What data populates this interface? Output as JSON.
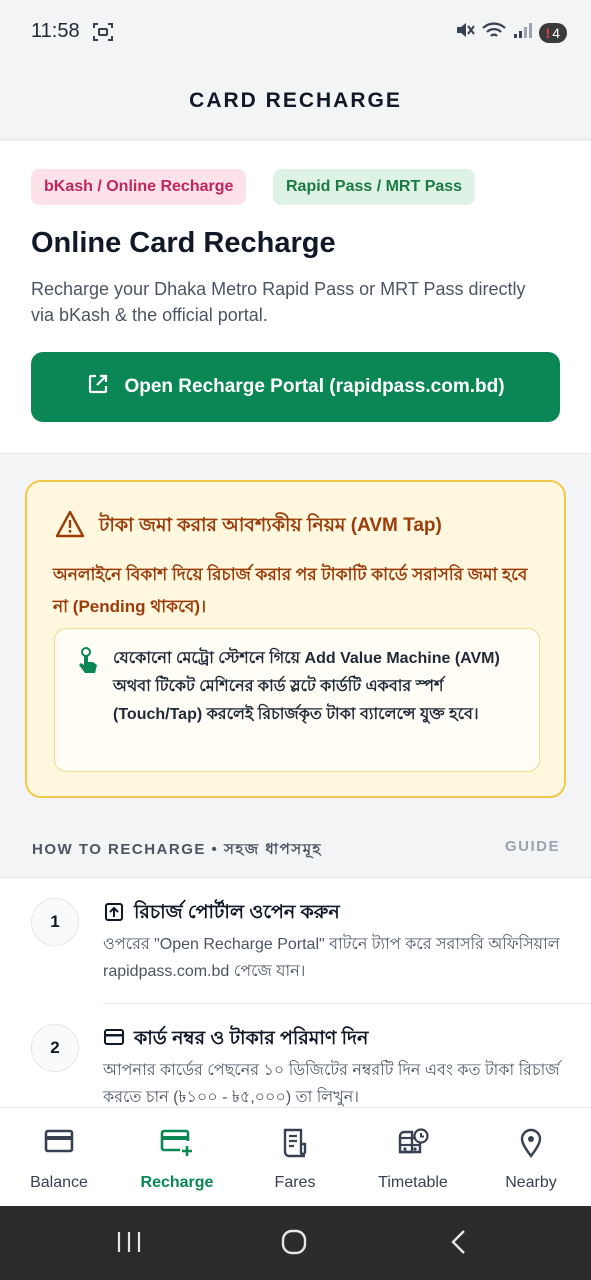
{
  "status_bar": {
    "time": "11:58",
    "notification_count": "4"
  },
  "header": {
    "title": "CARD RECHARGE"
  },
  "hero": {
    "chip_bkash": "bKash / Online Recharge",
    "chip_rapid": "Rapid Pass / MRT Pass",
    "title": "Online Card Recharge",
    "description": "Recharge your Dhaka Metro Rapid Pass or MRT Pass directly via bKash & the official portal.",
    "button_label": "Open Recharge Portal (rapidpass.com.bd)"
  },
  "warning": {
    "title": "টাকা জমা করার আবশ্যকীয় নিয়ম (AVM Tap)",
    "text": "অনলাইনে বিকাশ দিয়ে রিচার্জ করার পর টাকাটি কার্ডে সরাসরি জমা হবে না (Pending থাকবে)।",
    "instruction": "যেকোনো মেট্রো স্টেশনে গিয়ে Add Value Machine (AVM) অথবা টিকেট মেশিনের কার্ড স্লটে কার্ডটি একবার স্পর্শ (Touch/Tap) করলেই রিচার্জকৃত টাকা ব্যালেন্সে যুক্ত হবে।"
  },
  "section": {
    "title": "HOW TO RECHARGE • সহজ ধাপসমূহ",
    "guide": "GUIDE"
  },
  "steps": [
    {
      "number": "1",
      "icon": "upload-icon",
      "title": "রিচার্জ পোর্টাল ওপেন করুন",
      "description": "ওপরের \"Open Recharge Portal\" বাটনে ট্যাপ করে সরাসরি অফিসিয়াল rapidpass.com.bd পেজে যান।"
    },
    {
      "number": "2",
      "icon": "card-icon",
      "title": "কার্ড নম্বর ও টাকার পরিমাণ দিন",
      "description": "আপনার কার্ডের পেছনের ১০ ডিজিটের নম্বরটি দিন এবং কত টাকা রিচার্জ করতে চান (৳১০০ - ৳৫,০০০) তা লিখুন।"
    }
  ],
  "bottom_nav": [
    {
      "label": "Balance",
      "icon": "credit-card-icon"
    },
    {
      "label": "Recharge",
      "icon": "card-add-icon",
      "active": true
    },
    {
      "label": "Fares",
      "icon": "receipt-icon"
    },
    {
      "label": "Timetable",
      "icon": "bus-clock-icon"
    },
    {
      "label": "Nearby",
      "icon": "location-pin-icon"
    }
  ],
  "colors": {
    "primary": "#0a8754",
    "warning_bg": "#fff7de",
    "warning_border": "#f2c94c",
    "warning_text": "#9a3d0a",
    "bkash_pink": "#c0265e"
  }
}
